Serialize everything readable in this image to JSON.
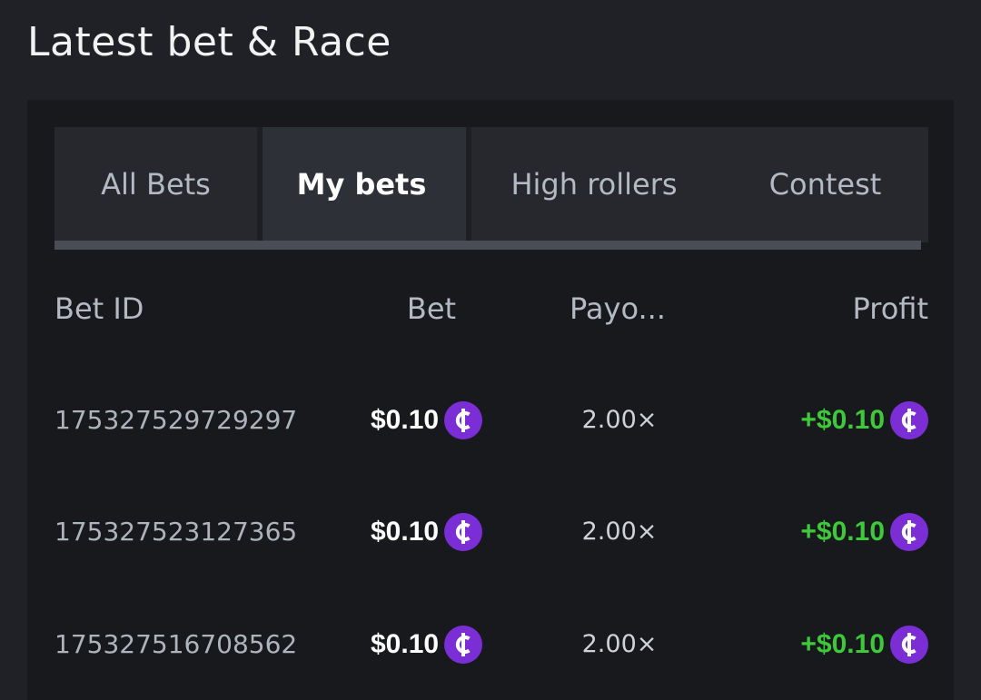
{
  "section": {
    "title": "Latest bet & Race"
  },
  "tabs": [
    {
      "label": "All Bets",
      "active": false
    },
    {
      "label": "My bets",
      "active": true
    },
    {
      "label": "High rollers",
      "active": false
    },
    {
      "label": "Contest",
      "active": false
    }
  ],
  "table": {
    "headers": {
      "bet_id": "Bet ID",
      "bet": "Bet",
      "payout": "Payo...",
      "profit": "Profit"
    },
    "rows": [
      {
        "bet_id": "175327529729297",
        "bet": "$0.10",
        "payout": "2.00×",
        "profit": "+$0.10"
      },
      {
        "bet_id": "175327523127365",
        "bet": "$0.10",
        "payout": "2.00×",
        "profit": "+$0.10"
      },
      {
        "bet_id": "175327516708562",
        "bet": "$0.10",
        "payout": "2.00×",
        "profit": "+$0.10"
      }
    ]
  },
  "icons": {
    "coin": "coin-icon"
  },
  "colors": {
    "background": "#1f2126",
    "panel": "#18191d",
    "tab_bg": "#26282e",
    "active_tab_bg": "#2d3037",
    "profit": "#3ec93a",
    "coin": "#7c2ed6"
  }
}
